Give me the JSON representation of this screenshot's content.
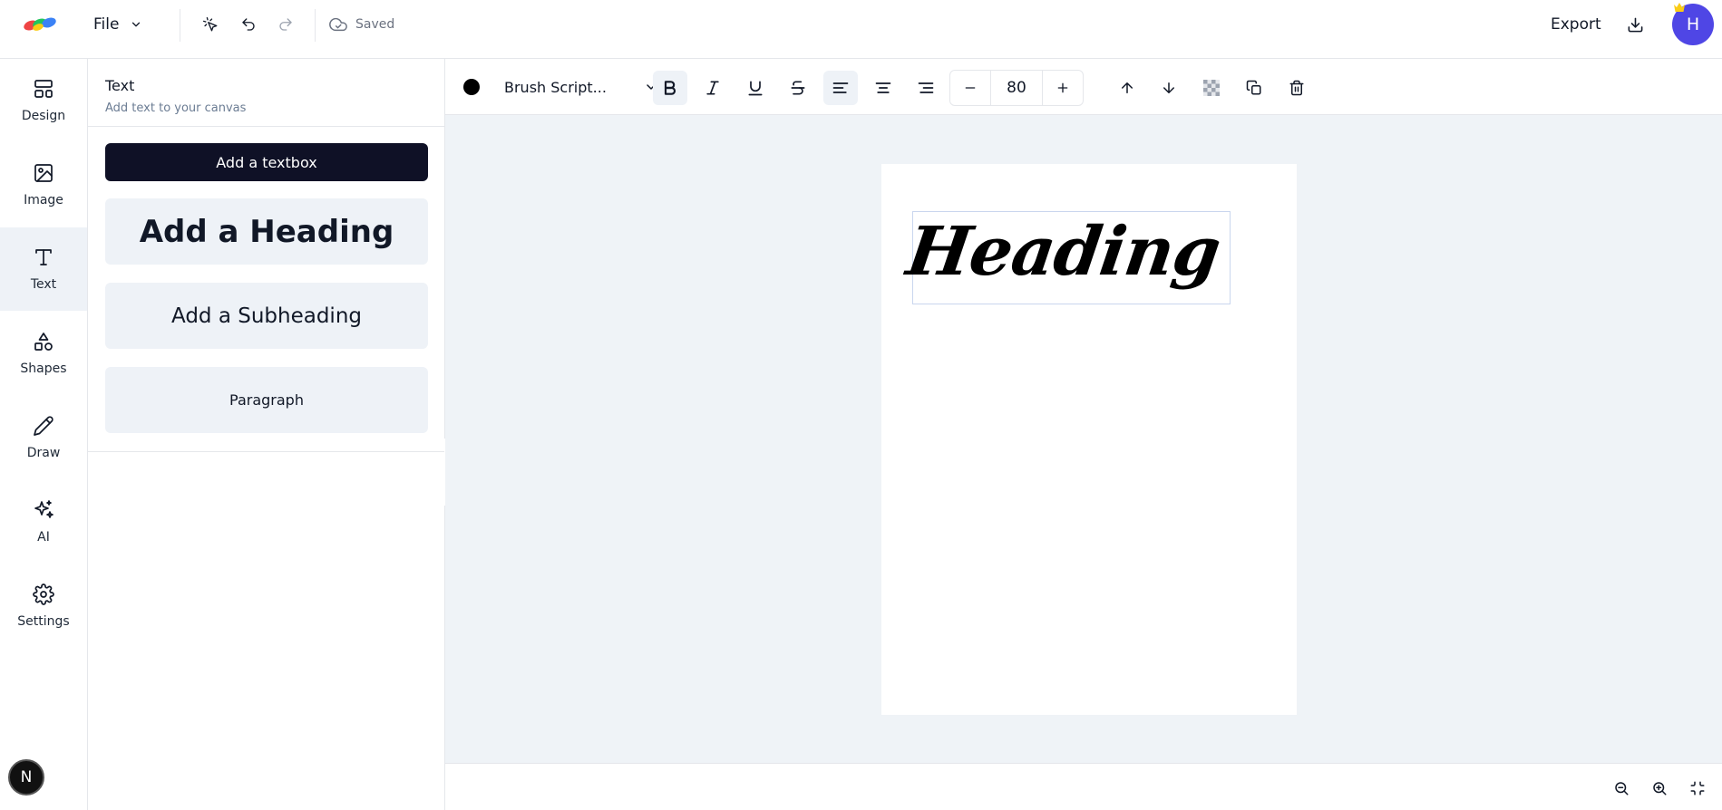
{
  "header": {
    "file_label": "File",
    "saved_label": "Saved",
    "export_label": "Export",
    "avatar_initial": "H"
  },
  "rail": {
    "items": [
      {
        "label": "Design",
        "icon": "layout-icon"
      },
      {
        "label": "Image",
        "icon": "image-icon"
      },
      {
        "label": "Text",
        "icon": "text-icon",
        "active": true
      },
      {
        "label": "Shapes",
        "icon": "shapes-icon"
      },
      {
        "label": "Draw",
        "icon": "pencil-icon"
      },
      {
        "label": "AI",
        "icon": "sparkles-icon"
      },
      {
        "label": "Settings",
        "icon": "gear-icon"
      }
    ],
    "badge": "N"
  },
  "panel": {
    "title": "Text",
    "subtitle": "Add text to your canvas",
    "add_textbox": "Add a textbox",
    "add_heading": "Add a Heading",
    "add_subheading": "Add a Subheading",
    "paragraph": "Paragraph"
  },
  "toolbar": {
    "text_color": "#000000",
    "font_family": "Brush Script...",
    "font_size": "80",
    "bold_active": true,
    "align_left_active": true
  },
  "canvas": {
    "heading_text": "Heading"
  },
  "colors": {
    "primary_button": "#0f1126",
    "avatar": "#4f46e5",
    "workspace_bg": "#eff3f7",
    "active_bg": "#eef2f7"
  }
}
